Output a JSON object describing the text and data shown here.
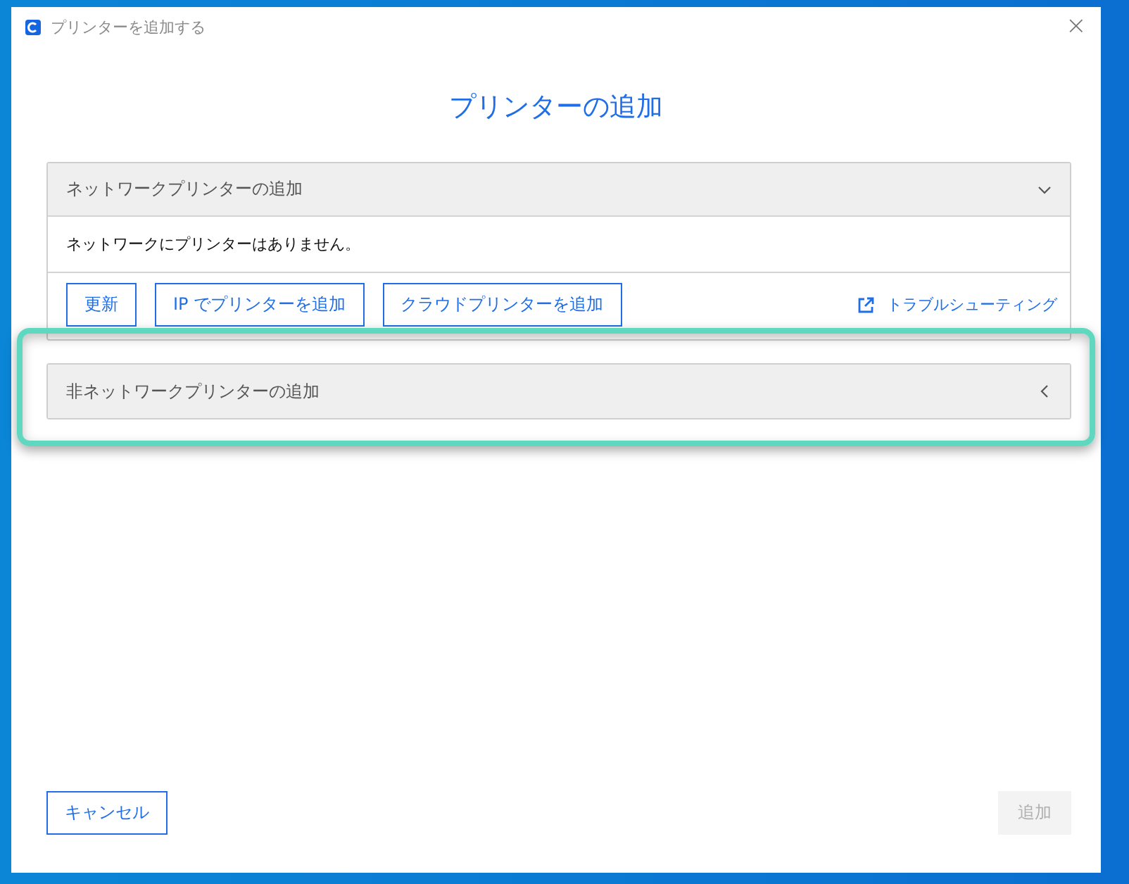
{
  "window": {
    "title": "プリンターを追加する",
    "close": "×"
  },
  "heading": "プリンターの追加",
  "sections": [
    {
      "title": "ネットワークプリンターの追加",
      "expanded": true,
      "message": "ネットワークにプリンターはありません。",
      "buttons": [
        "更新",
        "IP でプリンターを追加",
        "クラウドプリンターを追加"
      ],
      "link": "トラブルシューティング"
    },
    {
      "title": "非ネットワークプリンターの追加",
      "expanded": false
    }
  ],
  "footer": {
    "cancel": "キャンセル",
    "add": {
      "label": "追加",
      "disabled": true
    }
  }
}
